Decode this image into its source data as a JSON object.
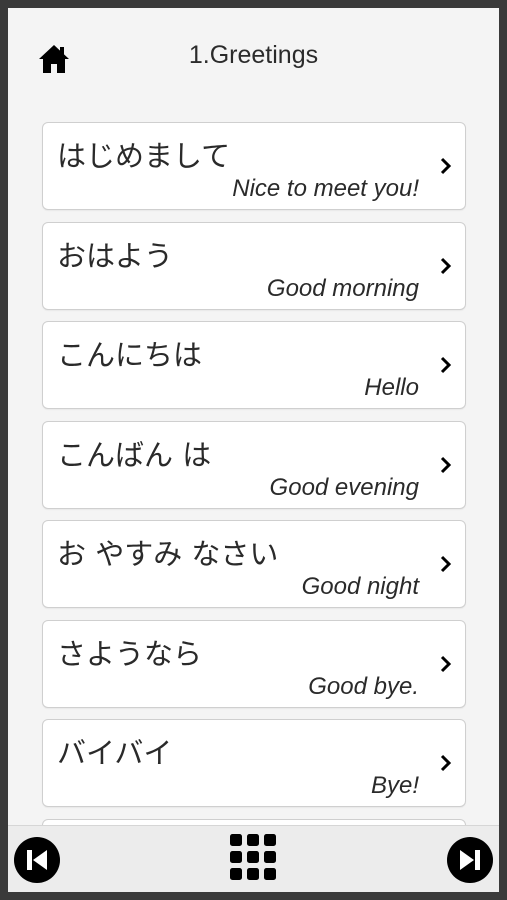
{
  "header": {
    "title": "1.Greetings",
    "home_icon": "home-icon"
  },
  "phrases": [
    {
      "jp": "はじめまして",
      "en": "Nice to meet you!"
    },
    {
      "jp": "おはよう",
      "en": "Good morning"
    },
    {
      "jp": "こんにちは",
      "en": "Hello"
    },
    {
      "jp": "こんばん は",
      "en": "Good evening"
    },
    {
      "jp": "お やすみ なさい",
      "en": "Good night"
    },
    {
      "jp": "さようなら",
      "en": "Good bye."
    },
    {
      "jp": "バイバイ",
      "en": "Bye!"
    }
  ],
  "footer": {
    "prev_icon": "skip-previous-icon",
    "grid_icon": "grid-menu-icon",
    "next_icon": "skip-next-icon"
  },
  "colors": {
    "background": "#f4f4f4",
    "card": "#ffffff",
    "card_border": "#cfcfcf",
    "text": "#2a2a2a",
    "icon": "#000000"
  }
}
